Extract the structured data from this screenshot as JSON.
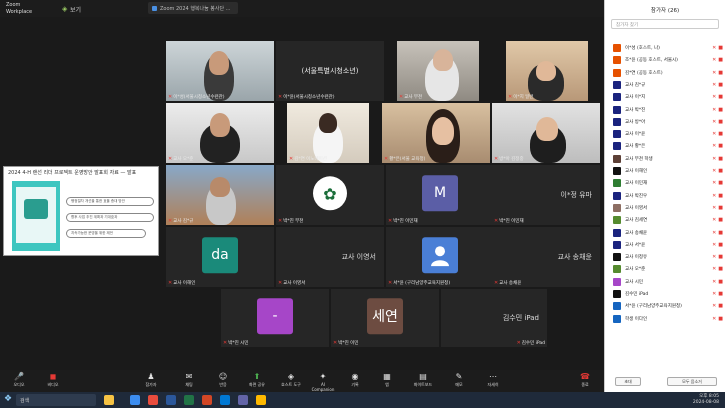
{
  "topbar": {
    "app_line1": "Zoom",
    "app_line2": "Workplace",
    "shield_label": "보기",
    "meeting_title": "Zoom 2024 행복나눔 봉사단 ...",
    "colors": {
      "bg": "#1c1c1c"
    }
  },
  "share": {
    "header": "2024 4-H 랜선 리더 프로젝트 운영방안 발표회 자료 — 발표",
    "lines": [
      "행정절차 개선을 통한 효율 증대 방안",
      "향후 사업 추진 계획과 기대효과",
      "지속가능한 운영을 위한 제언"
    ]
  },
  "tiles": [
    {
      "id": "t1",
      "name": "이*성(서울시청소년수련관)",
      "type": "video",
      "active": true
    },
    {
      "id": "t2",
      "name": "이*윤(서울시청소년수련관)",
      "type": "text",
      "center": "(서울특별시청소년)",
      "active": false
    },
    {
      "id": "t3",
      "name": "교사 부천",
      "type": "video",
      "active": false
    },
    {
      "id": "t4",
      "name": "이*지 일반",
      "type": "video",
      "active": false
    },
    {
      "id": "t5",
      "name": "교사 오*준",
      "type": "video",
      "active": false
    },
    {
      "id": "t6",
      "name": "김*연 이노베이션",
      "type": "video",
      "active": false
    },
    {
      "id": "t7",
      "name": "황*은(서울 교육청)",
      "type": "video",
      "active": false
    },
    {
      "id": "t8",
      "name": "방*아 김정중",
      "type": "video",
      "active": false
    },
    {
      "id": "t9",
      "name": "교사 김*규",
      "type": "video",
      "active": false
    },
    {
      "id": "t10",
      "name": "박*진 부천",
      "type": "logo",
      "active": false
    },
    {
      "id": "t11",
      "name": "박*진 이민재",
      "type": "avatar",
      "letter": "M",
      "color": "#5b5ea6",
      "active": false
    },
    {
      "id": "t12",
      "name": "박*진 이민재",
      "type": "sidename",
      "side": "이*정 유마",
      "active": false
    },
    {
      "id": "t13",
      "name": "교사 이해인",
      "type": "avatar",
      "letter": "da",
      "color": "#1a8a7a",
      "active": false
    },
    {
      "id": "t14",
      "name": "교사 이영서",
      "type": "sidename",
      "side": "교사 이영서",
      "active": false
    },
    {
      "id": "t15",
      "name": "서*윤 (구리남양주교육지원청)",
      "type": "person",
      "active": false
    },
    {
      "id": "t16",
      "name": "교사 송채윤",
      "type": "sidename",
      "side": "교사 송채윤",
      "active": false
    },
    {
      "id": "t17",
      "name": "박*진 시민",
      "type": "avatar",
      "letter": "-",
      "color": "#a646c8",
      "active": false
    },
    {
      "id": "t18",
      "name": "박*진 이민",
      "type": "avatar",
      "letter": "세연",
      "color": "#6d4c41",
      "active": false
    },
    {
      "id": "t19",
      "name": "김수민 iPad",
      "type": "sidename",
      "side": "김수민 iPad",
      "active": false
    }
  ],
  "toolbar": {
    "left": [
      {
        "label": "오디오",
        "icon": "mic-icon",
        "red": true
      },
      {
        "label": "비디오",
        "icon": "video-icon",
        "red": true
      }
    ],
    "center": [
      {
        "label": "참가자",
        "icon": "participants-icon"
      },
      {
        "label": "채팅",
        "icon": "chat-icon"
      },
      {
        "label": "반응",
        "icon": "reaction-icon"
      },
      {
        "label": "화면 공유",
        "icon": "share-icon",
        "green": true
      },
      {
        "label": "호스트 도구",
        "icon": "shield-icon"
      },
      {
        "label": "AI Companion",
        "icon": "ai-icon"
      },
      {
        "label": "기록",
        "icon": "record-icon"
      },
      {
        "label": "앱",
        "icon": "apps-icon"
      },
      {
        "label": "화이트보드",
        "icon": "whiteboard-icon"
      },
      {
        "label": "메모",
        "icon": "notes-icon"
      },
      {
        "label": "자세히",
        "icon": "more-icon"
      }
    ],
    "end_label": "종료"
  },
  "panel": {
    "title": "참가자 (26)",
    "search_placeholder": "참가자 찾기",
    "participants": [
      {
        "name": "이*성 (호스트, 나)",
        "color": "#e65100"
      },
      {
        "name": "조*윤 (공동 호스트, 서울시)",
        "color": "#e65100"
      },
      {
        "name": "김*연 (공동 호스트)",
        "color": "#e65100"
      },
      {
        "name": "교사 김*규",
        "color": "#1a237e"
      },
      {
        "name": "교사 이*지",
        "color": "#1a237e"
      },
      {
        "name": "교사 박*진",
        "color": "#1a237e"
      },
      {
        "name": "교사 방*아",
        "color": "#1a237e"
      },
      {
        "name": "교사 이*윤",
        "color": "#1a237e"
      },
      {
        "name": "교사 황*은",
        "color": "#1a237e"
      },
      {
        "name": "교사 부천 학생",
        "color": "#5d4037"
      },
      {
        "name": "교사 이해인",
        "color": "#111111"
      },
      {
        "name": "교사 이민재",
        "color": "#2e7d32"
      },
      {
        "name": "교사 박진우",
        "color": "#1a237e"
      },
      {
        "name": "교사 이영서",
        "color": "#8d6e63"
      },
      {
        "name": "교사 김세연",
        "color": "#558b2f"
      },
      {
        "name": "교사 송채윤",
        "color": "#1a237e"
      },
      {
        "name": "교사 서*윤",
        "color": "#1a237e"
      },
      {
        "name": "교사 이정유",
        "color": "#111111"
      },
      {
        "name": "교사 오*준",
        "color": "#558b2f"
      },
      {
        "name": "교사 시민",
        "color": "#a646c8"
      },
      {
        "name": "김수민 iPad",
        "color": "#111111"
      },
      {
        "name": "서*윤 (구리남양주교육지원청)",
        "color": "#1565c0"
      },
      {
        "name": "학생 이다인",
        "color": "#1565c0"
      }
    ],
    "invite_label": "초대",
    "mute_all_label": "모두 음소거"
  },
  "taskbar": {
    "search_placeholder": "검색",
    "time": "오후 8:05",
    "date": "2024-08-08"
  }
}
